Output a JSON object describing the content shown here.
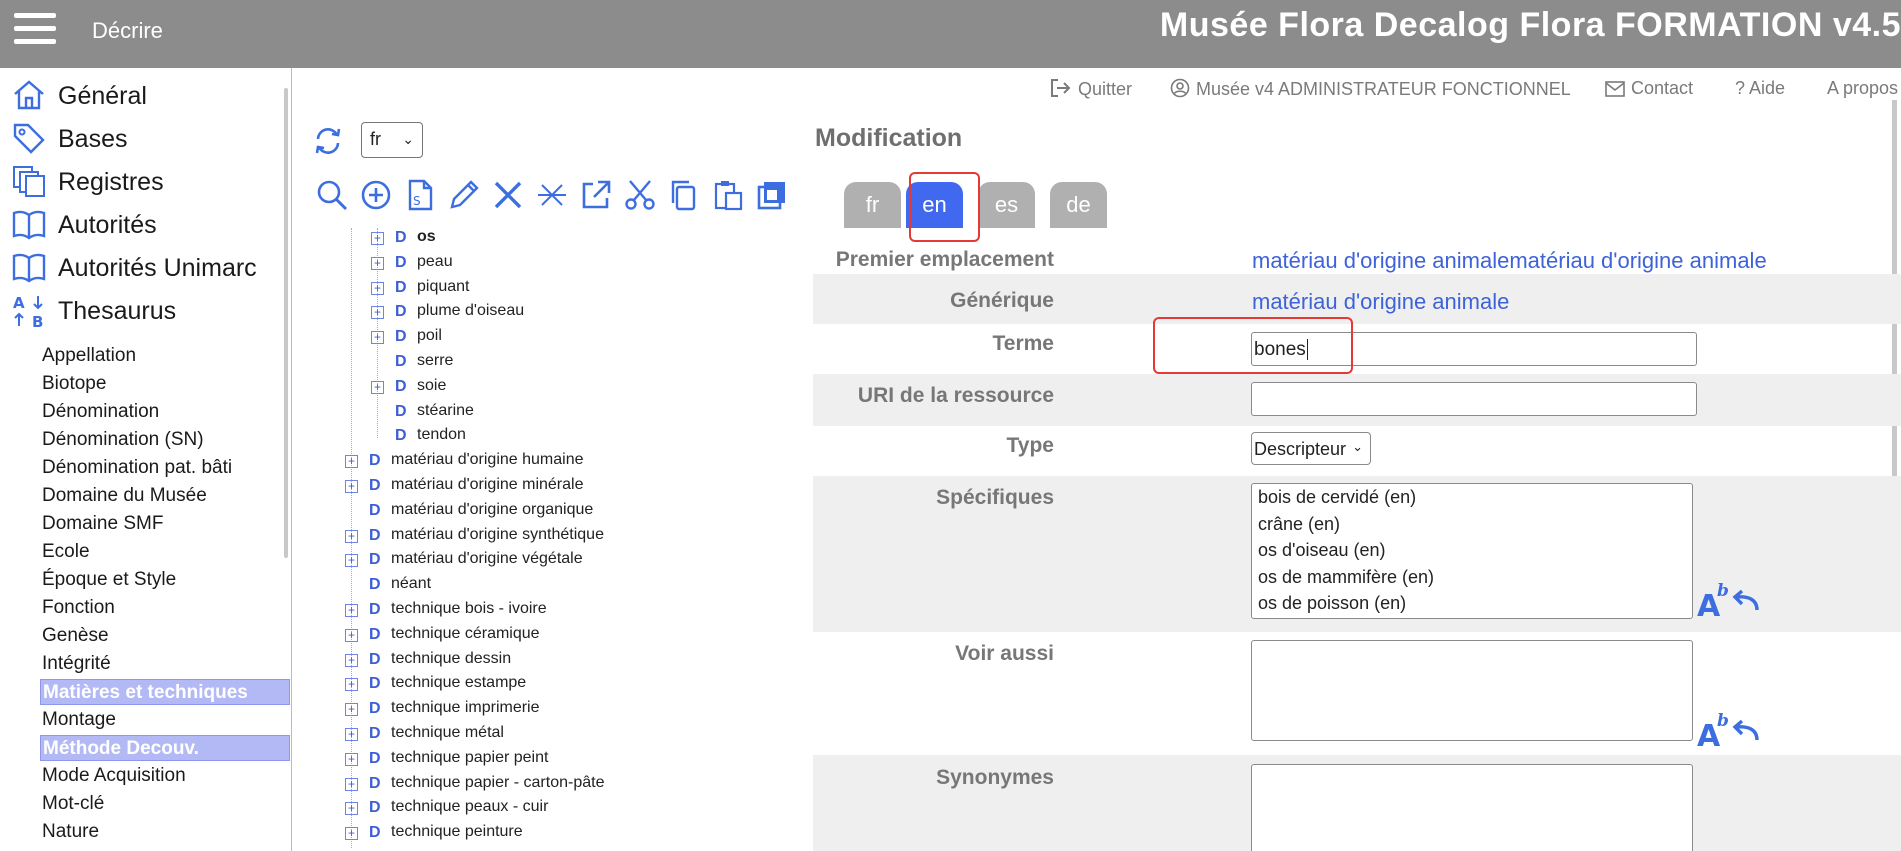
{
  "topbar": {
    "section": "Décrire",
    "app_title": "Musée Flora Decalog Flora FORMATION v4.5"
  },
  "userbar": {
    "quit": "Quitter",
    "user": "Musée v4 ADMINISTRATEUR FONCTIONNEL",
    "contact": "Contact",
    "help": "Aide",
    "about": "A propos"
  },
  "nav": {
    "main": [
      {
        "label": "Général",
        "icon": "home-icon"
      },
      {
        "label": "Bases",
        "icon": "tag-icon"
      },
      {
        "label": "Registres",
        "icon": "copy-icon"
      },
      {
        "label": "Autorités",
        "icon": "book-icon"
      },
      {
        "label": "Autorités Unimarc",
        "icon": "book-icon"
      },
      {
        "label": "Thesaurus",
        "icon": "sort-alpha-icon"
      }
    ],
    "thesaurus_items": [
      {
        "label": "Appellation",
        "selected": false
      },
      {
        "label": "Biotope",
        "selected": false
      },
      {
        "label": "Dénomination",
        "selected": false
      },
      {
        "label": "Dénomination (SN)",
        "selected": false
      },
      {
        "label": "Dénomination pat. bâti",
        "selected": false
      },
      {
        "label": "Domaine du Musée",
        "selected": false
      },
      {
        "label": "Domaine SMF",
        "selected": false
      },
      {
        "label": "Ecole",
        "selected": false
      },
      {
        "label": "Époque et Style",
        "selected": false
      },
      {
        "label": "Fonction",
        "selected": false
      },
      {
        "label": "Genèse",
        "selected": false
      },
      {
        "label": "Intégrité",
        "selected": false
      },
      {
        "label": "Matières et techniques",
        "selected": true
      },
      {
        "label": "Montage",
        "selected": false
      },
      {
        "label": "Méthode Decouv.",
        "selected": true
      },
      {
        "label": "Mode Acquisition",
        "selected": false
      },
      {
        "label": "Mot-clé",
        "selected": false
      },
      {
        "label": "Nature",
        "selected": false
      }
    ]
  },
  "tree": {
    "language": "fr",
    "tools": [
      "search-icon",
      "add-icon",
      "new-document-icon",
      "edit-icon",
      "delete-icon",
      "unlink-icon",
      "external-link-icon",
      "cut-icon",
      "copy-icon",
      "paste-icon",
      "move-icon"
    ],
    "nodes": [
      {
        "label": "os",
        "level": 2,
        "expandable": true,
        "bold": true
      },
      {
        "label": "peau",
        "level": 2,
        "expandable": true,
        "bold": false
      },
      {
        "label": "piquant",
        "level": 2,
        "expandable": true,
        "bold": false
      },
      {
        "label": "plume d'oiseau",
        "level": 2,
        "expandable": true,
        "bold": false
      },
      {
        "label": "poil",
        "level": 2,
        "expandable": true,
        "bold": false
      },
      {
        "label": "serre",
        "level": 2,
        "expandable": false,
        "bold": false
      },
      {
        "label": "soie",
        "level": 2,
        "expandable": true,
        "bold": false
      },
      {
        "label": "stéarine",
        "level": 2,
        "expandable": false,
        "bold": false
      },
      {
        "label": "tendon",
        "level": 2,
        "expandable": false,
        "bold": false
      },
      {
        "label": "matériau d'origine humaine",
        "level": 1,
        "expandable": true,
        "bold": false
      },
      {
        "label": "matériau d'origine minérale",
        "level": 1,
        "expandable": true,
        "bold": false
      },
      {
        "label": "matériau d'origine organique",
        "level": 1,
        "expandable": false,
        "bold": false
      },
      {
        "label": "matériau d'origine synthétique",
        "level": 1,
        "expandable": true,
        "bold": false
      },
      {
        "label": "matériau d'origine végétale",
        "level": 1,
        "expandable": true,
        "bold": false
      },
      {
        "label": "néant",
        "level": 1,
        "expandable": false,
        "bold": false
      },
      {
        "label": "technique bois - ivoire",
        "level": 1,
        "expandable": true,
        "bold": false
      },
      {
        "label": "technique céramique",
        "level": 1,
        "expandable": true,
        "bold": false
      },
      {
        "label": "technique dessin",
        "level": 1,
        "expandable": true,
        "bold": false
      },
      {
        "label": "technique estampe",
        "level": 1,
        "expandable": true,
        "bold": false
      },
      {
        "label": "technique imprimerie",
        "level": 1,
        "expandable": true,
        "bold": false
      },
      {
        "label": "technique métal",
        "level": 1,
        "expandable": true,
        "bold": false
      },
      {
        "label": "technique papier peint",
        "level": 1,
        "expandable": true,
        "bold": false
      },
      {
        "label": "technique papier - carton-pâte",
        "level": 1,
        "expandable": true,
        "bold": false
      },
      {
        "label": "technique peaux - cuir",
        "level": 1,
        "expandable": true,
        "bold": false
      },
      {
        "label": "technique peinture",
        "level": 1,
        "expandable": true,
        "bold": false
      }
    ],
    "node_letter": "D"
  },
  "form": {
    "title": "Modification",
    "tabs": [
      {
        "label": "fr",
        "active": false
      },
      {
        "label": "en",
        "active": true
      },
      {
        "label": "es",
        "active": false
      },
      {
        "label": "de",
        "active": false
      }
    ],
    "premier_emplacement": {
      "label": "Premier emplacement",
      "value": "matériau d'origine animalematériau d'origine animale"
    },
    "generique": {
      "label": "Générique",
      "value": "matériau d'origine animale"
    },
    "terme": {
      "label": "Terme",
      "value": "bones"
    },
    "uri": {
      "label": "URI de la ressource",
      "value": ""
    },
    "type": {
      "label": "Type",
      "value": "Descripteur"
    },
    "specifiques": {
      "label": "Spécifiques",
      "items": [
        "bois de cervidé (en)",
        "crâne (en)",
        "os d'oiseau (en)",
        "os de mammifère (en)",
        "os de poisson (en)"
      ]
    },
    "voir_aussi": {
      "label": "Voir aussi"
    },
    "synonymes": {
      "label": "Synonymes"
    },
    "accent_color": "#4169f0",
    "highlight_color": "#e53935"
  }
}
